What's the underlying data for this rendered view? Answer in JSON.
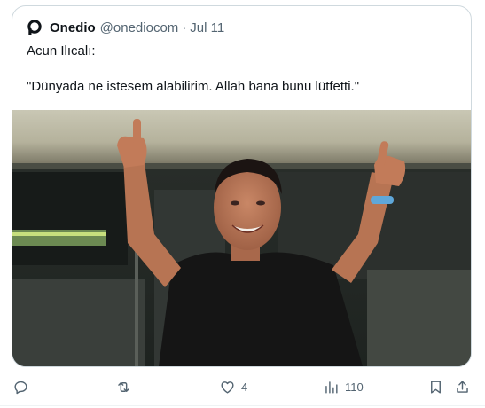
{
  "tweet": {
    "display_name": "Onedio",
    "handle": "@onediocom",
    "separator": "·",
    "date": "Jul 11",
    "text_line1": "Acun Ilıcalı:",
    "text_line2": "\"Dünyada ne istesem alabilirim. Allah bana bunu lütfetti.\""
  },
  "actions": {
    "reply_icon": "reply-icon",
    "retweet_icon": "retweet-icon",
    "like_icon": "heart-icon",
    "like_count": "4",
    "views_icon": "views-chart-icon",
    "views_count": "110",
    "bookmark_icon": "bookmark-icon",
    "share_icon": "share-icon"
  },
  "colors": {
    "text": "#0f1419",
    "secondary": "#536471",
    "border": "#cfd9de"
  }
}
